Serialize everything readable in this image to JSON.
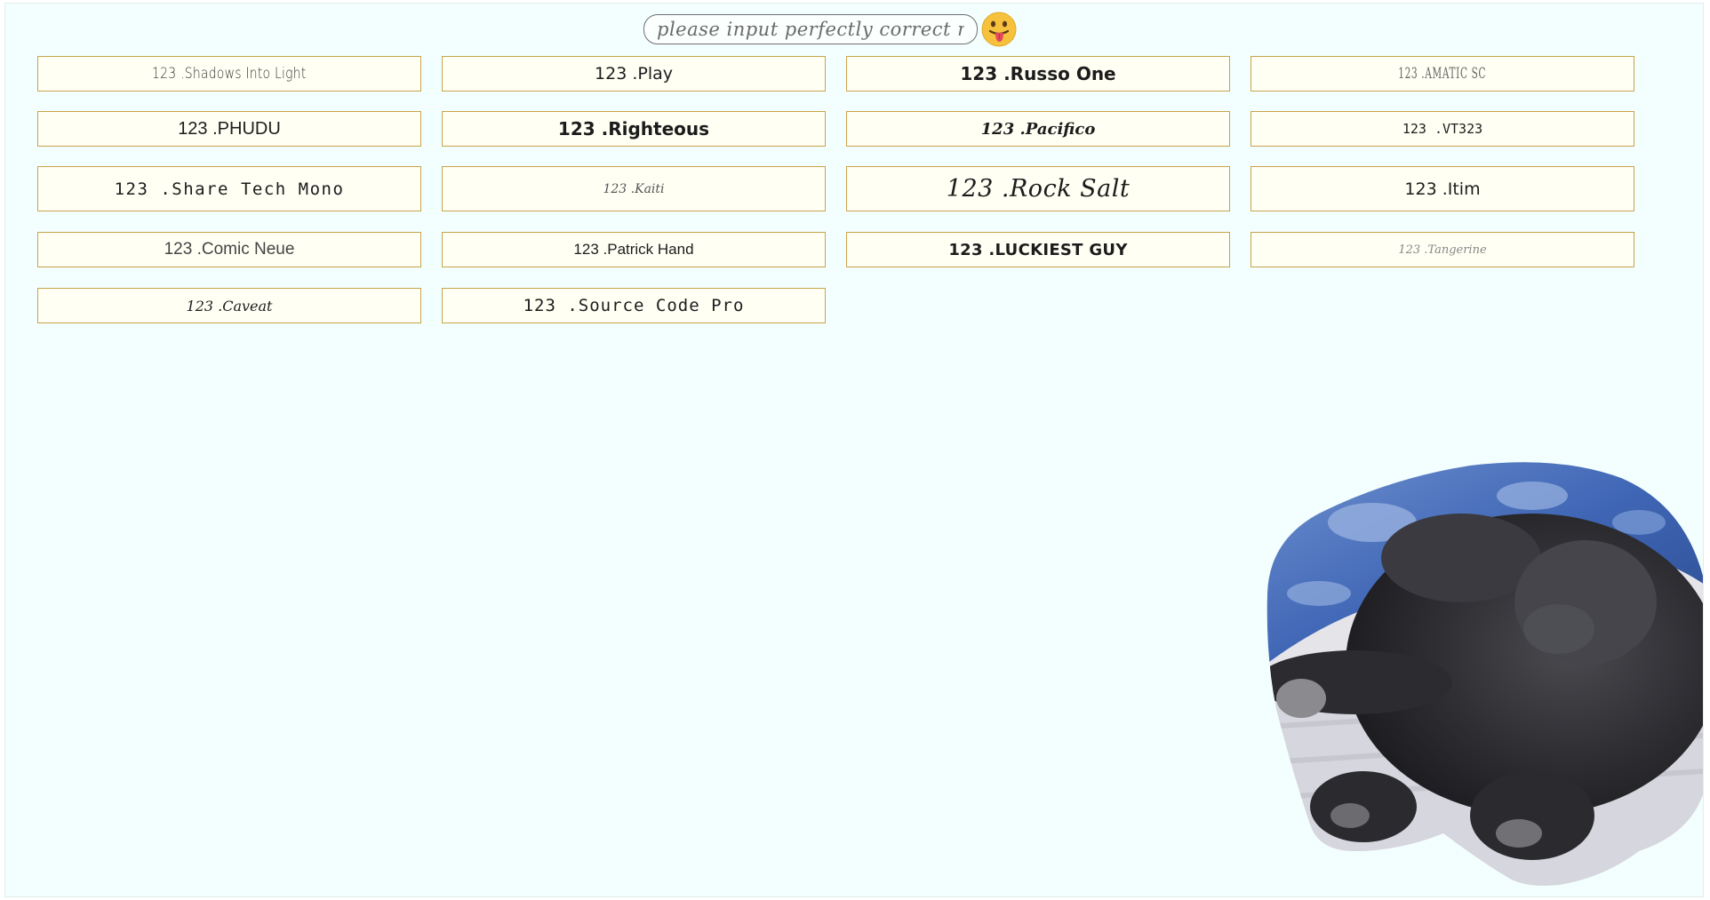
{
  "search": {
    "placeholder": "please input perfectly correct name!!",
    "value": ""
  },
  "emoji": {
    "icon": "tongue-out-face-icon",
    "color": "#f6c23e"
  },
  "fonts": [
    {
      "label": "123 .Shadows Into Light"
    },
    {
      "label": "123 .Play"
    },
    {
      "label": "123 .Russo One"
    },
    {
      "label": "123 .AMATIC SC"
    },
    {
      "label": "123 .PHUDU"
    },
    {
      "label": "123 .Righteous"
    },
    {
      "label": "123 .Pacifico"
    },
    {
      "label": "123 .VT323"
    },
    {
      "label": "123 .Share Tech Mono"
    },
    {
      "label": "123 .Kaiti"
    },
    {
      "label": "123 .Rock Salt"
    },
    {
      "label": "123 .Itim"
    },
    {
      "label": "123 .Comic Neue"
    },
    {
      "label": "123 .Patrick Hand"
    },
    {
      "label": "123 .LUCKIEST GUY"
    },
    {
      "label": "123 .Tangerine"
    },
    {
      "label": "123 .Caveat"
    },
    {
      "label": "123 .Source Code Pro"
    }
  ],
  "colors": {
    "page_background": "#f3fffe",
    "button_background": "#fffff4",
    "button_border": "#c9a24a"
  },
  "photo": {
    "icon": "sleeping-dog-photo"
  }
}
